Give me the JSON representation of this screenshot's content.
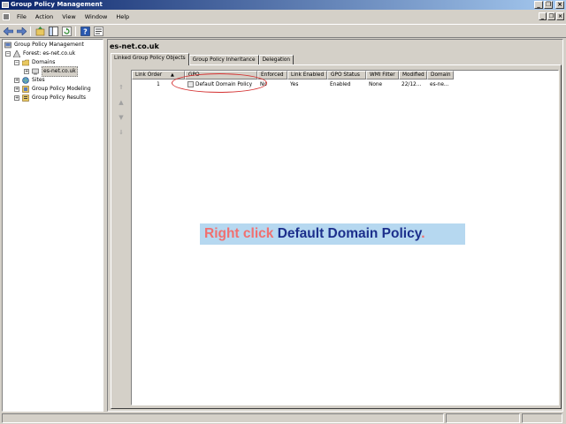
{
  "window": {
    "title": "Group Policy Management"
  },
  "menu": [
    "File",
    "Action",
    "View",
    "Window",
    "Help"
  ],
  "toolbar": {
    "icons": [
      "back-icon",
      "forward-icon",
      "up-icon",
      "show-hide-tree-icon",
      "refresh-icon",
      "help-icon",
      "properties-icon"
    ]
  },
  "tree": {
    "root": "Group Policy Management",
    "forest": "Forest: es-net.co.uk",
    "domains": "Domains",
    "domain": "es-net.co.uk",
    "sites": "Sites",
    "modeling": "Group Policy Modeling",
    "results": "Group Policy Results"
  },
  "content": {
    "title": "es-net.co.uk",
    "tabs": [
      "Linked Group Policy Objects",
      "Group Policy Inheritance",
      "Delegation"
    ],
    "columns": [
      "Link Order",
      "GPO",
      "Enforced",
      "Link Enabled",
      "GPO Status",
      "WMI Filter",
      "Modified",
      "Domain"
    ],
    "rows": [
      {
        "link_order": "1",
        "gpo": "Default Domain Policy",
        "enforced": "No",
        "link_enabled": "Yes",
        "gpo_status": "Enabled",
        "wmi_filter": "None",
        "modified": "22/12...",
        "domain": "es-ne..."
      }
    ]
  },
  "callout": {
    "action": "Right click",
    "target": "Default Domain Policy",
    "end": "."
  },
  "colors": {
    "callout_bg": "#b6d8f0",
    "callout_action": "#f07070",
    "callout_target": "#1c2f8c",
    "highlight": "#d43030"
  }
}
